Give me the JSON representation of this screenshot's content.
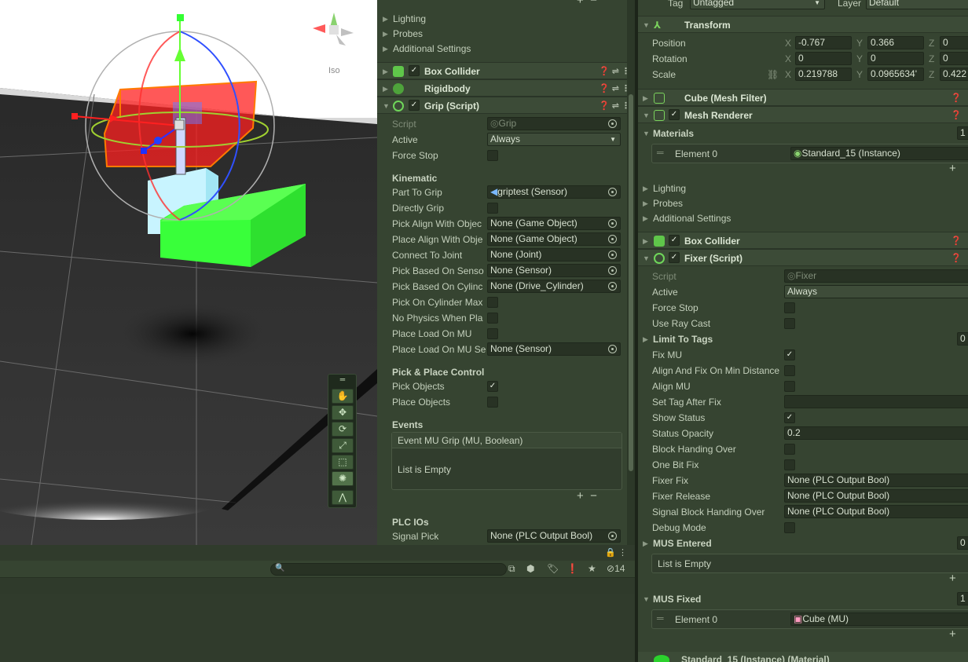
{
  "scene": {
    "view_label": "Iso"
  },
  "mid": {
    "top_folds": [
      "Lighting",
      "Probes",
      "Additional Settings"
    ],
    "components": [
      {
        "name": "Box Collider",
        "checked": true
      },
      {
        "name": "Rigidbody",
        "checked": false
      },
      {
        "name": "Grip (Script)",
        "checked": true
      }
    ],
    "grip": {
      "script_label": "Script",
      "script_value": "Grip",
      "active_label": "Active",
      "active_value": "Always",
      "force_stop_label": "Force Stop",
      "kinematic_header": "Kinematic",
      "fields": [
        {
          "label": "Part To Grip",
          "value": "griptest (Sensor)"
        },
        {
          "label": "Directly Grip",
          "value": ""
        },
        {
          "label": "Pick Align With Objec",
          "value": "None (Game Object)"
        },
        {
          "label": "Place Align With Obje",
          "value": "None (Game Object)"
        },
        {
          "label": "Connect To Joint",
          "value": "None (Joint)"
        },
        {
          "label": "Pick Based On Senso",
          "value": "None (Sensor)"
        },
        {
          "label": "Pick Based On Cylinc",
          "value": "None (Drive_Cylinder)"
        },
        {
          "label": "Pick On Cylinder Max",
          "value": ""
        },
        {
          "label": "No Physics When Pla",
          "value": ""
        },
        {
          "label": "Place Load On MU",
          "value": ""
        },
        {
          "label": "Place Load On MU Se",
          "value": "None (Sensor)"
        }
      ],
      "pp_header": "Pick & Place Control",
      "pick_objects": "Pick Objects",
      "place_objects": "Place Objects",
      "events_header": "Events",
      "event_name": "Event MU Grip (MU, Boolean)",
      "list_empty": "List is Empty",
      "plc_header": "PLC IOs",
      "signal_pick_label": "Signal Pick",
      "signal_pick_value": "None (PLC Output Bool)"
    }
  },
  "right": {
    "tag_label": "Tag",
    "tag_value": "Untagged",
    "layer_label": "Layer",
    "layer_value": "Default",
    "transform": {
      "title": "Transform",
      "position": {
        "label": "Position",
        "x": "-0.767",
        "y": "0.366",
        "z": "0"
      },
      "rotation": {
        "label": "Rotation",
        "x": "0",
        "y": "0",
        "z": "0"
      },
      "scale": {
        "label": "Scale",
        "x": "0.219788",
        "y": "0.0965634'",
        "z": "0.422"
      }
    },
    "mesh_filter": "Cube (Mesh Filter)",
    "mesh_renderer": "Mesh Renderer",
    "materials_label": "Materials",
    "materials_count": "1",
    "element0_label": "Element 0",
    "element0_value": "Standard_15 (Instance)",
    "folds": [
      "Lighting",
      "Probes",
      "Additional Settings"
    ],
    "box_collider": "Box Collider",
    "fixer": {
      "title": "Fixer (Script)",
      "script_label": "Script",
      "script_value": "Fixer",
      "active_label": "Active",
      "active_value": "Always",
      "rows": [
        {
          "label": "Force Stop",
          "type": "check",
          "checked": false
        },
        {
          "label": "Use Ray Cast",
          "type": "check",
          "checked": false
        },
        {
          "label": "Limit To Tags",
          "type": "fold",
          "count": "0"
        },
        {
          "label": "Fix MU",
          "type": "check",
          "checked": true
        },
        {
          "label": "Align And Fix On Min Distance",
          "type": "check",
          "checked": false
        },
        {
          "label": "Align MU",
          "type": "check",
          "checked": false
        },
        {
          "label": "Set Tag After Fix",
          "type": "text",
          "value": ""
        },
        {
          "label": "Show Status",
          "type": "check",
          "checked": true
        },
        {
          "label": "Status Opacity",
          "type": "text",
          "value": "0.2"
        },
        {
          "label": "Block Handing Over",
          "type": "check",
          "checked": false
        },
        {
          "label": "One Bit Fix",
          "type": "check",
          "checked": false
        },
        {
          "label": "Fixer Fix",
          "type": "text",
          "value": "None (PLC Output Bool)"
        },
        {
          "label": "Fixer Release",
          "type": "text",
          "value": "None (PLC Output Bool)"
        },
        {
          "label": "Signal Block Handing Over",
          "type": "text",
          "value": "None (PLC Output Bool)"
        },
        {
          "label": "Debug Mode",
          "type": "check",
          "checked": false
        },
        {
          "label": "MUS Entered",
          "type": "fold",
          "count": "0"
        }
      ],
      "list_empty": "List is Empty",
      "mus_fixed_label": "MUS Fixed",
      "mus_fixed_count": "1",
      "mus_element_label": "Element 0",
      "mus_element_value": "Cube (MU)"
    },
    "bottom_material": "Standard_15 (Instance) (Material)"
  },
  "console": {
    "hidden_count": "14"
  }
}
